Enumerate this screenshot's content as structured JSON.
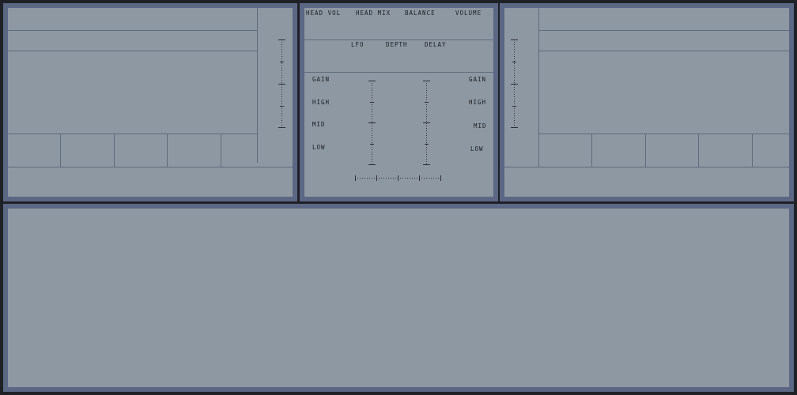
{
  "mixer": {
    "top_labels": [
      "HEAD VOL",
      "HEAD MIX",
      "BALANCE",
      "VOLUME"
    ],
    "effect_labels": [
      "LFO",
      "DEPTH",
      "DELAY"
    ],
    "eq_left": [
      "GAIN",
      "HIGH",
      "MID",
      "LOW"
    ],
    "eq_right": [
      "GAIN",
      "HIGH",
      "MID",
      "LOW"
    ]
  },
  "colors": {
    "background": "#1f2127",
    "panel_border": "#5b6784",
    "panel_fill": "#8e98a2",
    "text": "#1a1d22"
  }
}
